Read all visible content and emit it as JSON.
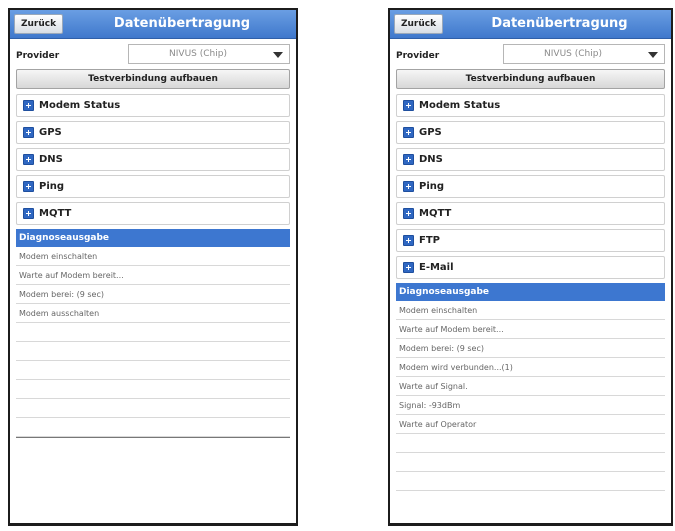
{
  "screens": [
    {
      "back_label": "Zurück",
      "title": "Datenübertragung",
      "provider_label": "Provider",
      "provider_value": "NIVUS (Chip)",
      "test_button": "Testverbindung aufbauen",
      "sections": [
        "Modem Status",
        "GPS",
        "DNS",
        "Ping",
        "MQTT"
      ],
      "diag_title": "Diagnoseausgabe",
      "diag_lines": [
        "Modem einschalten",
        "Warte auf Modem bereit...",
        "Modem berei: (9 sec)",
        "Modem ausschalten",
        "",
        "",
        "",
        "",
        "",
        ""
      ]
    },
    {
      "back_label": "Zurück",
      "title": "Datenübertragung",
      "provider_label": "Provider",
      "provider_value": "NIVUS (Chip)",
      "test_button": "Testverbindung aufbauen",
      "sections": [
        "Modem Status",
        "GPS",
        "DNS",
        "Ping",
        "MQTT",
        "FTP",
        "E-Mail"
      ],
      "diag_title": "Diagnoseausgabe",
      "diag_lines": [
        "Modem einschalten",
        "Warte auf Modem bereit...",
        "Modem berei: (9 sec)",
        "Modem wird verbunden...(1)",
        "Warte auf Signal.",
        "Signal: -93dBm",
        "Warte auf Operator",
        "",
        "",
        ""
      ]
    }
  ]
}
